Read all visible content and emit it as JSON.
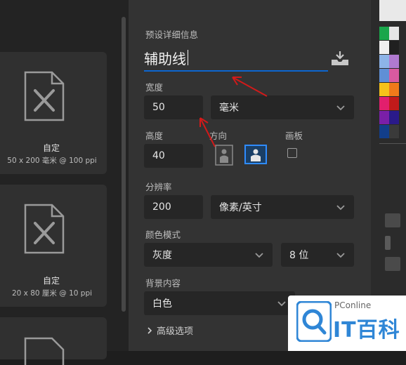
{
  "presets": [
    {
      "name": "自定",
      "dims": "50 x 200 毫米 @ 100 ppi"
    },
    {
      "name": "自定",
      "dims": "20 x 80 厘米 @ 10 ppi"
    }
  ],
  "details": {
    "section_title": "预设详细信息",
    "doc_name": "辅助线",
    "width": {
      "label": "宽度",
      "value": "50",
      "unit": "毫米"
    },
    "height": {
      "label": "高度",
      "value": "40"
    },
    "orientation": {
      "label": "方向",
      "selected": "landscape"
    },
    "artboard": {
      "label": "画板",
      "checked": false
    },
    "resolution": {
      "label": "分辨率",
      "value": "200",
      "unit": "像素/英寸"
    },
    "color_mode": {
      "label": "颜色模式",
      "mode": "灰度",
      "bits": "8 位"
    },
    "background": {
      "label": "背景内容",
      "value": "白色"
    },
    "advanced": "高级选项"
  },
  "watermark": {
    "brand": "PConline",
    "name": "IT百科"
  },
  "colors": {
    "accent": "#0d66d0",
    "arrow": "#d11a1a",
    "panel": "#333333",
    "field": "#262626"
  }
}
